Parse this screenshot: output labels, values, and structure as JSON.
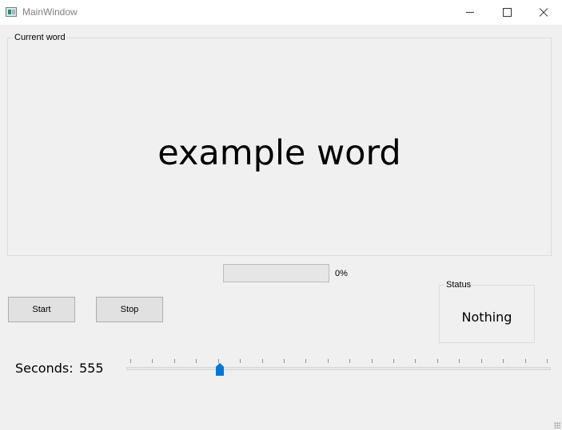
{
  "window": {
    "title": "MainWindow",
    "icon": "app-window-icon",
    "controls": [
      "minimize-icon",
      "maximize-icon",
      "close-icon"
    ]
  },
  "word_group": {
    "title": "Current word",
    "word": "example word"
  },
  "progress": {
    "value_percent": 0,
    "text": "0%"
  },
  "buttons": {
    "start_label": "Start",
    "stop_label": "Stop"
  },
  "status_group": {
    "title": "Status",
    "value": "Nothing"
  },
  "seconds": {
    "label": "Seconds:",
    "value": "555"
  },
  "slider": {
    "value_fraction": 0.215,
    "tick_count": 20,
    "accent_color": "#0078d7"
  }
}
